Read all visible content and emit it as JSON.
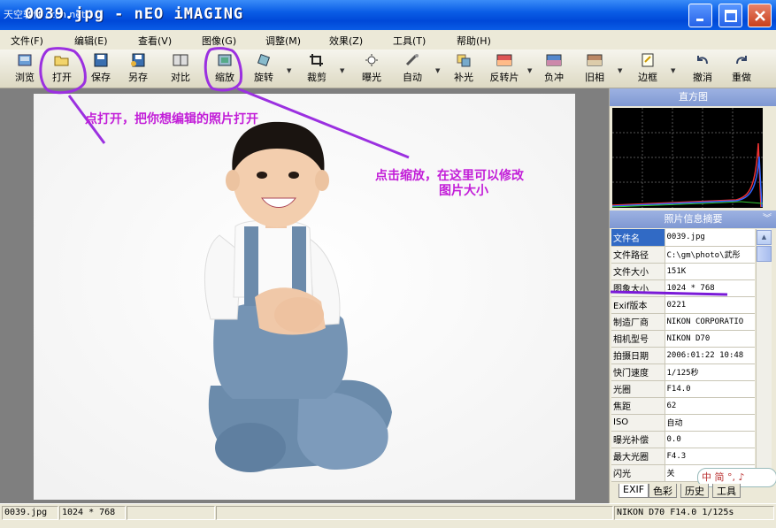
{
  "window": {
    "watermark": "天空软件 ctcn.net",
    "title": "0039.jpg - nEO iMAGING"
  },
  "menu": [
    "文件(F)",
    "编辑(E)",
    "查看(V)",
    "图像(G)",
    "调整(M)",
    "效果(Z)",
    "工具(T)",
    "帮助(H)"
  ],
  "toolbar": [
    {
      "label": "浏览",
      "icon": "browse-icon"
    },
    {
      "label": "打开",
      "icon": "open-folder-icon"
    },
    {
      "label": "保存",
      "icon": "save-icon"
    },
    {
      "label": "另存",
      "icon": "save-as-icon"
    },
    {
      "label": "对比",
      "icon": "compare-icon"
    },
    {
      "label": "缩放",
      "icon": "resize-icon"
    },
    {
      "label": "旋转",
      "icon": "rotate-icon"
    },
    {
      "label": "裁剪",
      "icon": "crop-icon"
    },
    {
      "label": "曝光",
      "icon": "exposure-icon"
    },
    {
      "label": "自动",
      "icon": "auto-icon"
    },
    {
      "label": "补光",
      "icon": "fill-light-icon"
    },
    {
      "label": "反转片",
      "icon": "slide-film-icon"
    },
    {
      "label": "负冲",
      "icon": "cross-process-icon"
    },
    {
      "label": "旧相",
      "icon": "old-photo-icon"
    },
    {
      "label": "边框",
      "icon": "frame-icon"
    },
    {
      "label": "撤消",
      "icon": "undo-icon"
    },
    {
      "label": "重做",
      "icon": "redo-icon"
    }
  ],
  "histogram_title": "直方图",
  "info_title": "照片信息摘要",
  "info_rows": [
    {
      "k": "文件名",
      "v": "0039.jpg"
    },
    {
      "k": "文件路径",
      "v": "C:\\gm\\photo\\武彤"
    },
    {
      "k": "文件大小",
      "v": "151K"
    },
    {
      "k": "图象大小",
      "v": "1024 * 768"
    },
    {
      "k": "Exif版本",
      "v": "0221"
    },
    {
      "k": "制造厂商",
      "v": "NIKON CORPORATIO"
    },
    {
      "k": "相机型号",
      "v": "NIKON D70"
    },
    {
      "k": "拍摄日期",
      "v": "2006:01:22 10:48"
    },
    {
      "k": "快门速度",
      "v": "1/125秒"
    },
    {
      "k": "光圈",
      "v": "F14.0"
    },
    {
      "k": "焦距",
      "v": "62"
    },
    {
      "k": "ISO",
      "v": "自动"
    },
    {
      "k": "曝光补偿",
      "v": "0.0"
    },
    {
      "k": "最大光圈",
      "v": "F4.3"
    },
    {
      "k": "闪光",
      "v": "关"
    }
  ],
  "tabs": [
    "EXIF",
    "色彩",
    "历史",
    "工具"
  ],
  "ime": "中 简 °, ♪",
  "status": {
    "filename": "0039.jpg",
    "size": "1024 * 768",
    "camera": "NIKON D70 F14.0 1/125s"
  },
  "annotations": {
    "open_note": "点打开，把你想编辑的照片打开",
    "resize_note_1": "点击缩放，在这里可以修改",
    "resize_note_2": "图片大小"
  },
  "colors": {
    "title_bar": "#0a5de6",
    "annotation": "#9b30e0",
    "selection": "#316ac5"
  }
}
